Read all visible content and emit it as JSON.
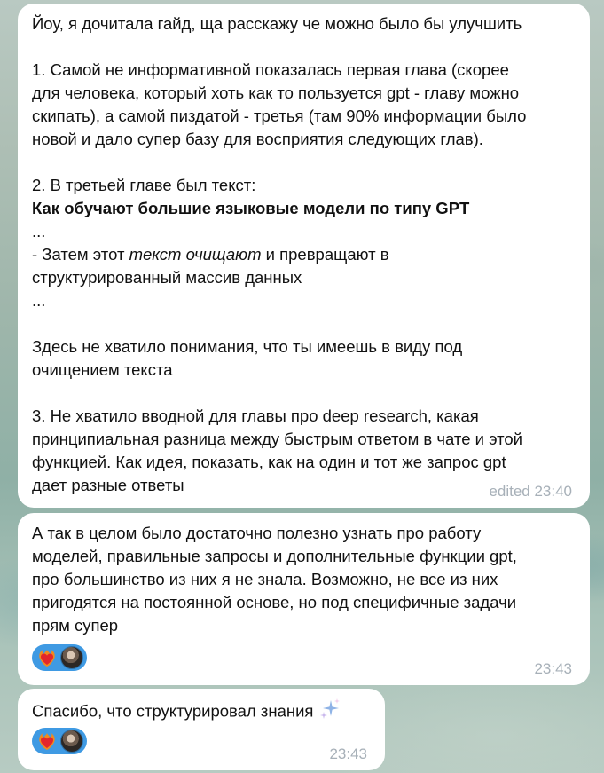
{
  "messages": [
    {
      "lines": [
        "Йоу, я дочитала гайд, ща расскажу че можно было бы улучшить",
        "",
        "1. Самой не информативной показалась первая глава (скорее",
        "для человека, который хоть как то пользуется gpt - главу можно",
        "скипать), а самой пиздатой - третья (там 90% информации было",
        "новой и дало супер базу для восприятия следующих глав).",
        "",
        "2. В третьей главе был текст:",
        "Как обучают большие языковые модели по типу GPT",
        "...",
        "- Затем этот ",
        "структурированный массив данных",
        "...",
        "",
        "Здесь не хватило понимания, что ты имеешь в виду под",
        "очищением текста",
        "",
        "3. Не хватило вводной для главы про deep research, какая",
        "принципиальная разница между быстрым ответом в чате и этой",
        "функцией. Как идея, показать, как на один и тот же запрос gpt",
        "дает разные ответы"
      ],
      "italic_part": "текст очищают",
      "after_italic": " и превращают в",
      "time": "edited 23:40"
    },
    {
      "lines": [
        "А так в целом было достаточно полезно узнать про работу",
        "моделей, правильные запросы и дополнительные функции gpt,",
        "про большинство из них я не знала. Возможно, не все из них",
        "пригодятся на постоянной основе, но под специфичные задачи",
        "прям супер"
      ],
      "time": "23:43",
      "reaction": "heart-on-fire"
    },
    {
      "text": "Спасибо, что структурировал знания",
      "time": "23:43",
      "reaction": "heart-on-fire"
    }
  ]
}
